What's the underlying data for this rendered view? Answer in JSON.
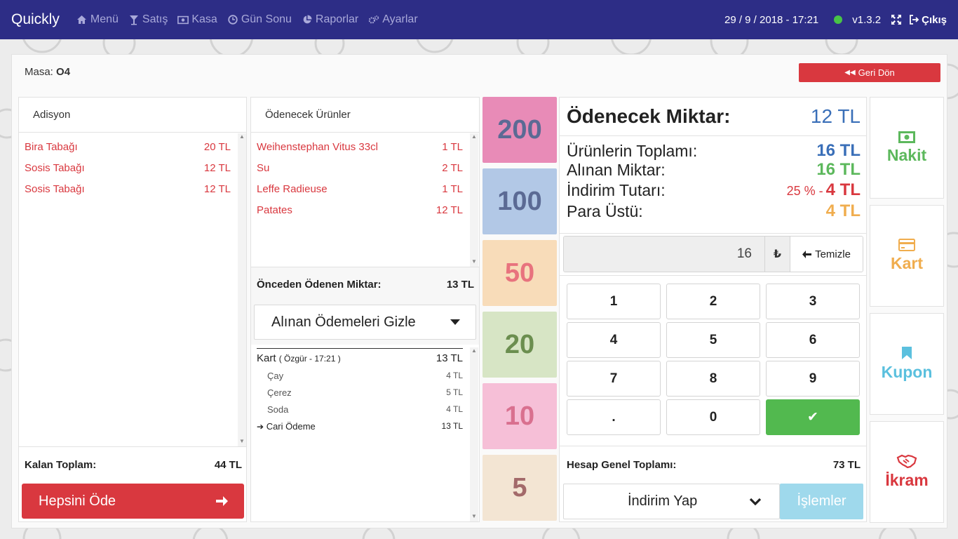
{
  "app": {
    "brand": "Quickly"
  },
  "nav": [
    {
      "label": "Menü",
      "icon": "home-icon"
    },
    {
      "label": "Satış",
      "icon": "cocktail-icon"
    },
    {
      "label": "Kasa",
      "icon": "money-icon"
    },
    {
      "label": "Gün Sonu",
      "icon": "clock-icon"
    },
    {
      "label": "Raporlar",
      "icon": "pie-chart-icon"
    },
    {
      "label": "Ayarlar",
      "icon": "gears-icon"
    }
  ],
  "topbar": {
    "datetime": "29 / 9 / 2018 - 17:21",
    "version": "v1.3.2",
    "logout_label": "Çıkış",
    "status_color": "#48c447"
  },
  "masa": {
    "label": "Masa:",
    "value": "O4"
  },
  "back_label": "Geri Dön",
  "adisyon": {
    "title": "Adisyon",
    "items": [
      {
        "name": "Bira Tabağı",
        "price": "20 TL"
      },
      {
        "name": "Sosis Tabağı",
        "price": "12 TL"
      },
      {
        "name": "Sosis Tabağı",
        "price": "12 TL"
      }
    ],
    "remaining_label": "Kalan Toplam:",
    "remaining_value": "44 TL",
    "pay_all_label": "Hepsini Öde"
  },
  "odenecek": {
    "title": "Ödenecek Ürünler",
    "items": [
      {
        "name": "Weihenstephan Vitus 33cl",
        "price": "1 TL"
      },
      {
        "name": "Su",
        "price": "2 TL"
      },
      {
        "name": "Leffe Radieuse",
        "price": "1 TL"
      },
      {
        "name": "Patates",
        "price": "12 TL"
      }
    ],
    "prev_paid_label": "Önceden Ödenen Miktar:",
    "prev_paid_value": "13 TL",
    "hide_payments_label": "Alınan Ödemeleri Gizle",
    "payment": {
      "method": "Kart",
      "detail": "( Özgür - 17:21 )",
      "amount": "13 TL",
      "items": [
        {
          "name": "Çay",
          "price": "4 TL"
        },
        {
          "name": "Çerez",
          "price": "5 TL"
        },
        {
          "name": "Soda",
          "price": "4 TL"
        }
      ],
      "cari_label": "Cari Ödeme",
      "cari_value": "13 TL"
    }
  },
  "money_buttons": [
    {
      "value": "200",
      "bg": "#e88bb7",
      "fg": "#5b6a94"
    },
    {
      "value": "100",
      "bg": "#b2c8e6",
      "fg": "#5b6a94"
    },
    {
      "value": "50",
      "bg": "#f8dcb9",
      "fg": "#e8737e"
    },
    {
      "value": "20",
      "bg": "#d7e5c5",
      "fg": "#6b8e4f"
    },
    {
      "value": "10",
      "bg": "#f6bfd7",
      "fg": "#d9708f"
    },
    {
      "value": "5",
      "bg": "#f3e5d3",
      "fg": "#a36a6a"
    }
  ],
  "summary": {
    "due_label": "Ödenecek Miktar:",
    "due_value": "12 TL",
    "products_total_label": "Ürünlerin Toplamı:",
    "products_total_value": "16 TL",
    "received_label": "Alınan Miktar:",
    "received_value": "16 TL",
    "discount_label": "İndirim Tutarı:",
    "discount_pct": "25 % -",
    "discount_value": "4 TL",
    "change_label": "Para Üstü:",
    "change_value": "4 TL"
  },
  "input": {
    "value": "16",
    "currency": "₺",
    "clear_label": "Temizle"
  },
  "keypad": [
    "1",
    "2",
    "3",
    "4",
    "5",
    "6",
    "7",
    "8",
    "9",
    ".",
    "0",
    "✔"
  ],
  "account_total": {
    "label": "Hesap Genel Toplamı:",
    "value": "73 TL"
  },
  "discount_button": "İndirim Yap",
  "actions_button": "İşlemler",
  "methods": [
    {
      "label": "Nakit",
      "icon": "cash-icon",
      "color": "#5cb85c"
    },
    {
      "label": "Kart",
      "icon": "credit-card-icon",
      "color": "#f0ad4e"
    },
    {
      "label": "Kupon",
      "icon": "bookmark-icon",
      "color": "#5bc0de"
    },
    {
      "label": "İkram",
      "icon": "handshake-icon",
      "color": "#d9383f"
    }
  ]
}
